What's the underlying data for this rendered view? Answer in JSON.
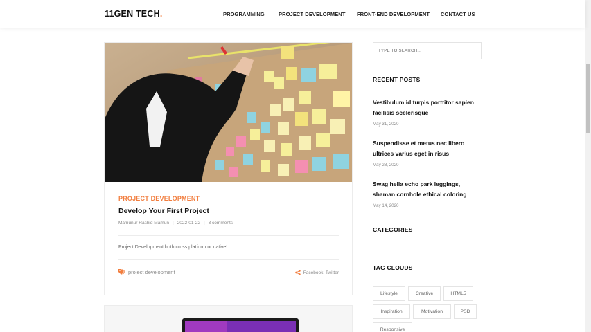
{
  "site": {
    "logo": "11GEN TECH",
    "logo_dot": "."
  },
  "nav": [
    {
      "label": "PROGRAMMING"
    },
    {
      "label": "PROJECT DEVELOPMENT"
    },
    {
      "label": "FRONT-END DEVELOPMENT"
    },
    {
      "label": "CONTACT US"
    }
  ],
  "colors": {
    "accent": "#f27e3f",
    "text": "#111111",
    "muted": "#888888",
    "border": "#ececec"
  },
  "post": {
    "category": "PROJECT DEVELOPMENT",
    "title": "Develop Your First Project",
    "author": "Mamunur Rashid Mamun",
    "date": "2022-01-22",
    "comments": "3 comments",
    "excerpt": "Project Development both cross platform or native!",
    "tag": "project development",
    "tag_icon": "tags-icon",
    "share_icon": "share-icon",
    "share_facebook": "Facebook",
    "share_sep": ", ",
    "share_twitter": "Twitter"
  },
  "sidebar": {
    "search_placeholder": "TYPE TO SEARCH...",
    "recent_title": "RECENT POSTS",
    "recent": [
      {
        "title": "Vestibulum id turpis porttitor sapien facilisis scelerisque",
        "date": "May 31, 2020"
      },
      {
        "title": "Suspendisse et metus nec libero ultrices varius eget in risus",
        "date": "May 28, 2020"
      },
      {
        "title": "Swag hella echo park leggings, shaman cornhole ethical coloring",
        "date": "May 14, 2020"
      }
    ],
    "categories_title": "CATEGORIES",
    "tags_title": "TAG CLOUDS",
    "tags": [
      "Lifestyle",
      "Creative",
      "HTML5",
      "Inspiration",
      "Motivation",
      "PSD",
      "Responsive"
    ]
  }
}
